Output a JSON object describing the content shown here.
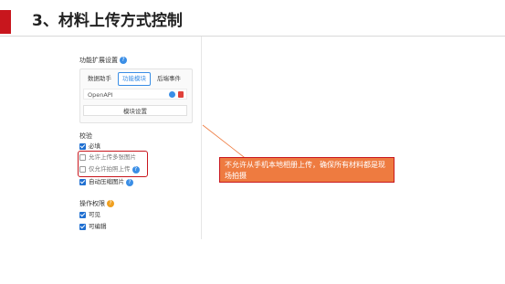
{
  "slide": {
    "title": "3、材料上传方式控制"
  },
  "panel": {
    "ext_settings_title": "功能扩展设置",
    "help_glyph": "?",
    "tabs": [
      "数据助手",
      "功能模块",
      "后端事件"
    ],
    "active_tab": "功能模块",
    "api_name": "OpenAPI",
    "module_settings_label": "模块设置",
    "validation_title": "校验",
    "validation_items": [
      {
        "label": "必填",
        "checked": true,
        "has_help": false
      },
      {
        "label": "允许上传多张图片",
        "checked": false,
        "has_help": false
      },
      {
        "label": "仅允许拍照上传",
        "checked": false,
        "has_help": true
      },
      {
        "label": "自动压缩图片",
        "checked": true,
        "has_help": true
      }
    ],
    "permissions_title": "操作权限",
    "permission_items": [
      {
        "label": "可见",
        "checked": true
      },
      {
        "label": "可编辑",
        "checked": true
      }
    ]
  },
  "callout": {
    "text": "不允许从手机本地相册上传，确保所有材料都是现场拍摄"
  },
  "colors": {
    "accent_red": "#c8161d",
    "callout_orange": "#ee7b40",
    "brand_blue": "#3a8ee6"
  }
}
